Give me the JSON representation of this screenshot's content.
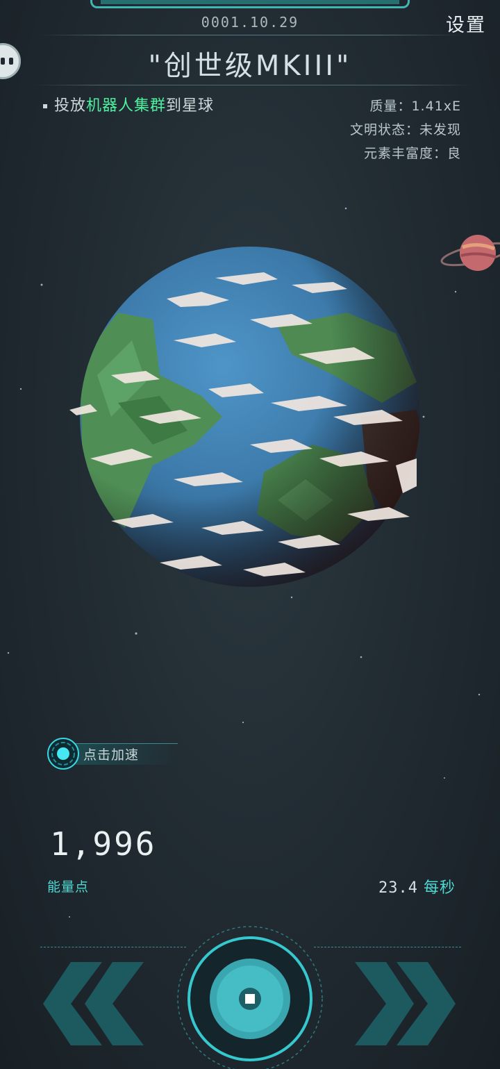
{
  "header": {
    "date": "0001.10.29",
    "settings_label": "设置",
    "ship_name": "\"创世级MKIII\""
  },
  "chat": {
    "icon": "chat-bubble-icon"
  },
  "task": {
    "prefix": "投放",
    "highlight": "机器人集群",
    "suffix": "到星球"
  },
  "stats": {
    "mass": "质量：1.41xE",
    "civilization": "文明状态：未发现",
    "elements": "元素丰富度：良"
  },
  "accelerate": {
    "label": "点击加速"
  },
  "energy": {
    "value": "1,996",
    "label": "能量点",
    "rate_value": "23.4",
    "rate_unit": "每秒"
  },
  "controls": {
    "left_icon": "double-chevron-left-icon",
    "right_icon": "double-chevron-right-icon",
    "center_icon": "core-button-icon"
  },
  "colors": {
    "accent": "#45d0cb",
    "highlight": "#4ef0a0",
    "background": "#222c33"
  }
}
